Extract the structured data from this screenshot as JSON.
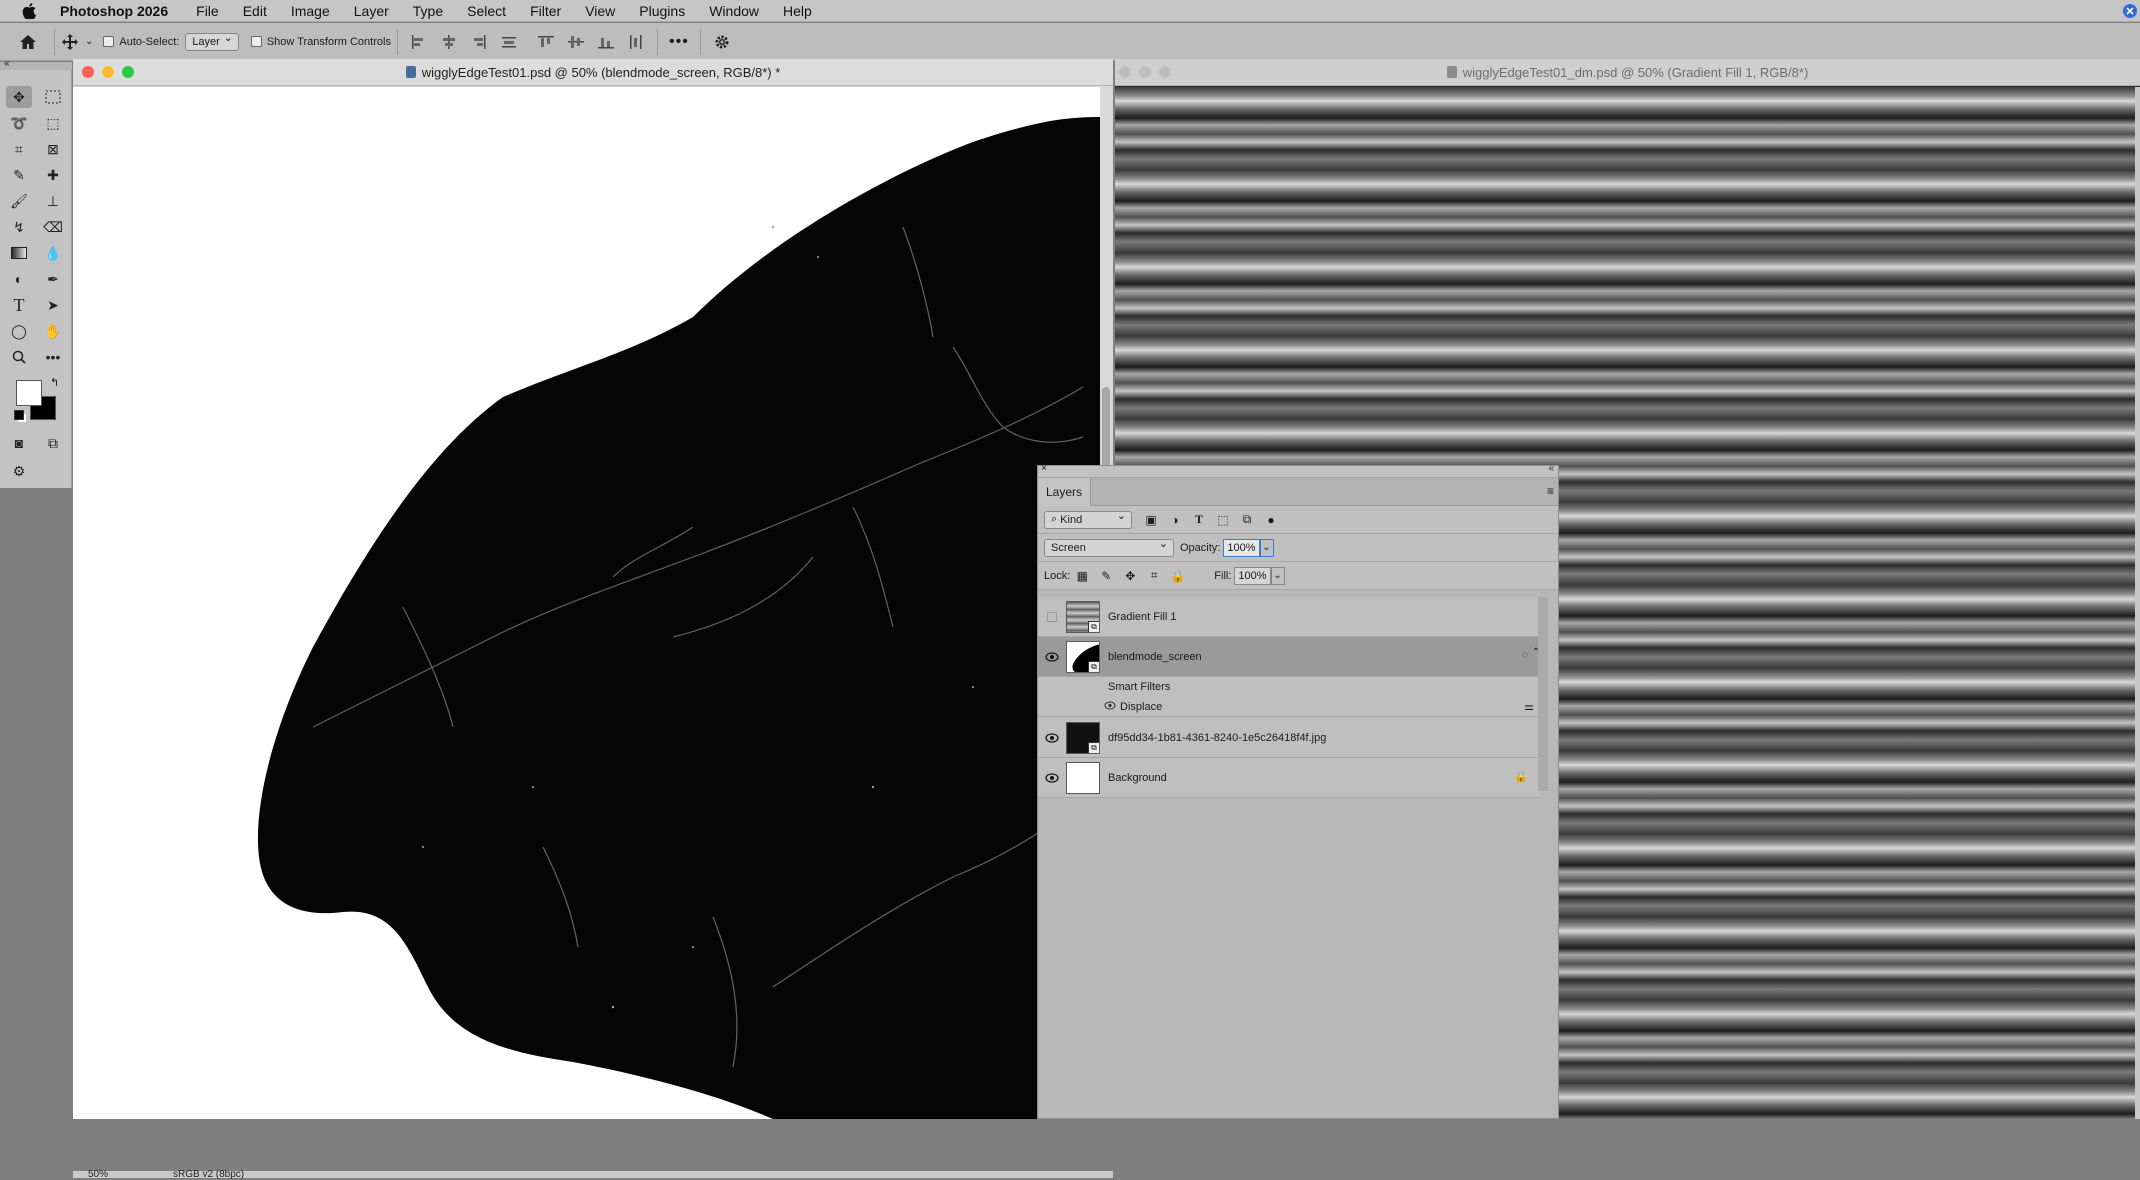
{
  "menu": {
    "app_name": "Photoshop 2026",
    "items": [
      "File",
      "Edit",
      "Image",
      "Layer",
      "Type",
      "Select",
      "Filter",
      "View",
      "Plugins",
      "Window",
      "Help"
    ]
  },
  "options_bar": {
    "auto_select_label": "Auto-Select:",
    "auto_select_value": "Layer",
    "show_transform_label": "Show Transform Controls"
  },
  "doc1": {
    "title": "wigglyEdgeTest01.psd @ 50% (blendmode_screen, RGB/8*) *",
    "status_zoom": "50%",
    "status_profile": "sRGB v2 (8bpc)"
  },
  "doc2": {
    "title": "wigglyEdgeTest01_dm.psd @ 50% (Gradient Fill 1, RGB/8*)"
  },
  "layers_panel": {
    "tab_label": "Layers",
    "filter_kind": "Kind",
    "blend_mode": "Screen",
    "opacity_label": "Opacity:",
    "opacity_value": "100%",
    "lock_label": "Lock:",
    "fill_label": "Fill:",
    "fill_value": "100%",
    "layers": [
      {
        "name": "Gradient Fill 1",
        "visible": false
      },
      {
        "name": "blendmode_screen",
        "visible": true,
        "selected": true
      },
      {
        "name": "df95dd34-1b81-4361-8240-1e5c26418f4f.jpg",
        "visible": true
      },
      {
        "name": "Background",
        "visible": true,
        "locked": true
      }
    ],
    "smart_filters_label": "Smart Filters",
    "displace_label": "Displace"
  },
  "colors": {
    "menubar": "#c6c6c6",
    "canvas_bg": "#ffffff",
    "selected_layer": "#9a9a9a",
    "traffic_red": "#fe5f57",
    "traffic_yellow": "#febc2e",
    "traffic_green": "#28c840"
  }
}
